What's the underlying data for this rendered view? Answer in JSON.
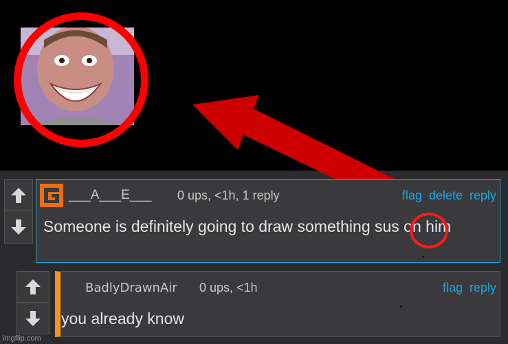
{
  "colors": {
    "accent": "#19a7e0",
    "reply_bar": "#f7941d",
    "annotation_red": "#ff0000",
    "panel": "#3a3a3c",
    "background": "#2b2b2d"
  },
  "meme_overlay": {
    "avatar": "avatar-photo",
    "circle": "red-circle-annotation",
    "arrow": "red-arrow-annotation"
  },
  "comments": [
    {
      "user_icon": "g-logo-icon",
      "username": "___A___E___",
      "meta": "0 ups, <1h, 1 reply",
      "actions": [
        "flag",
        "delete",
        "reply"
      ],
      "text": "Someone is definitely going to draw something sus on him"
    },
    {
      "username": "BadlyDrawnAir",
      "meta": "0 ups, <1h",
      "actions": [
        "flag",
        "reply"
      ],
      "text": "you already know"
    }
  ],
  "vote_icons": {
    "up": "arrow-up-icon",
    "down": "arrow-down-icon"
  },
  "watermark": "imgflip.com"
}
